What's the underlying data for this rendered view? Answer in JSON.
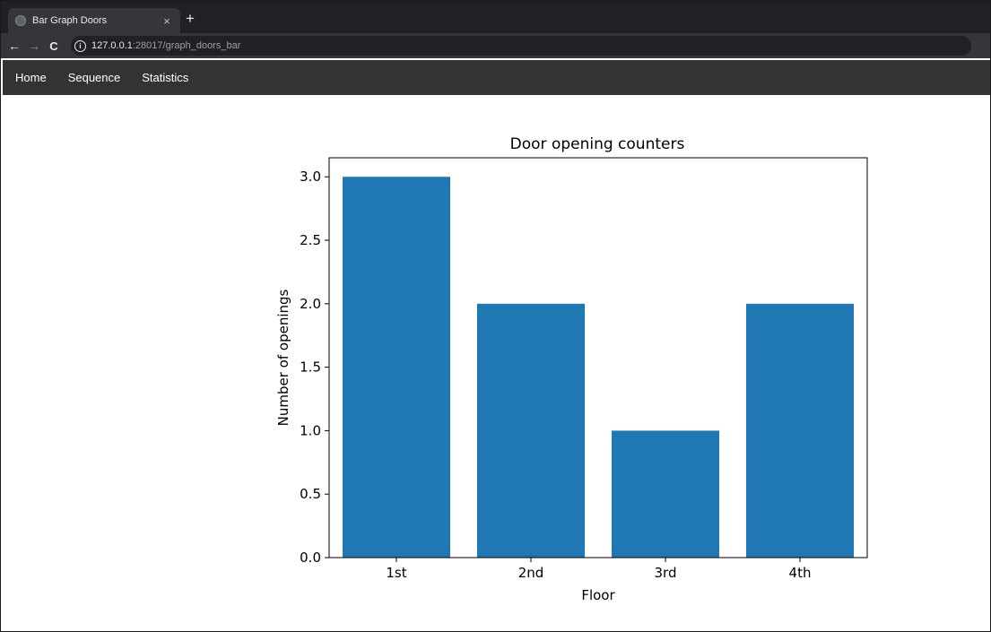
{
  "browser": {
    "tab_title": "Bar Graph Doors",
    "tab_close": "×",
    "new_tab": "+",
    "url_host": "127.0.0.1",
    "url_rest": ":28017/graph_doors_bar"
  },
  "navbar": {
    "links": [
      "Home",
      "Sequence",
      "Statistics"
    ]
  },
  "chart_data": {
    "type": "bar",
    "title": "Door opening counters",
    "xlabel": "Floor",
    "ylabel": "Number of openings",
    "categories": [
      "1st",
      "2nd",
      "3rd",
      "4th"
    ],
    "values": [
      3,
      2,
      1,
      2
    ],
    "ylim": [
      0,
      3.15
    ],
    "yticks": [
      "0.0",
      "0.5",
      "1.0",
      "1.5",
      "2.0",
      "2.5",
      "3.0"
    ],
    "bar_color": "#1f77b4",
    "grid": false
  }
}
